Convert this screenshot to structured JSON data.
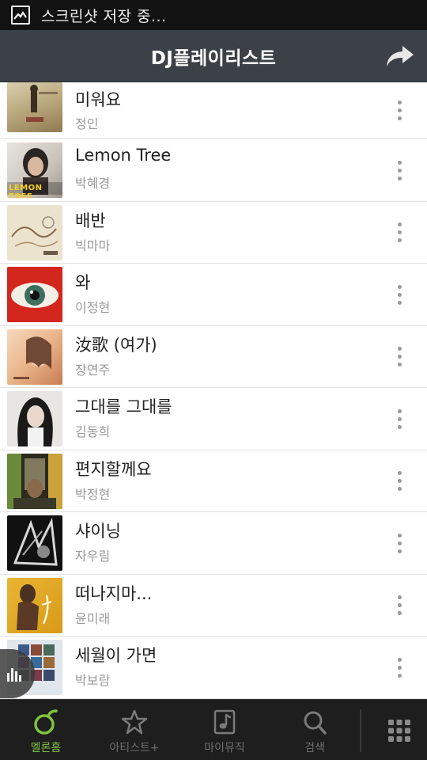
{
  "status_bar": {
    "text": "스크린샷 저장 중..."
  },
  "header": {
    "title": "DJ플레이리스트"
  },
  "songs": [
    {
      "title": "미워요",
      "artist": "정인"
    },
    {
      "title": "Lemon Tree",
      "artist": "박혜경",
      "art_text": "LEMON TREE"
    },
    {
      "title": "배반",
      "artist": "빅마마"
    },
    {
      "title": "와",
      "artist": "이정현"
    },
    {
      "title": "汝歌 (여가)",
      "artist": "장연주"
    },
    {
      "title": "그대를 그대를",
      "artist": "김동희"
    },
    {
      "title": "편지할께요",
      "artist": "박정현"
    },
    {
      "title": "샤이닝",
      "artist": "자우림"
    },
    {
      "title": "떠나지마...",
      "artist": "윤미래"
    },
    {
      "title": "세월이 가면",
      "artist": "박보람"
    }
  ],
  "tabs": [
    {
      "label": "멜론홈",
      "icon": "melon-home-icon",
      "active": true
    },
    {
      "label": "아티스트+",
      "icon": "star-icon",
      "active": false
    },
    {
      "label": "마이뮤직",
      "icon": "music-note-icon",
      "active": false
    },
    {
      "label": "검색",
      "icon": "search-icon",
      "active": false
    }
  ],
  "colors": {
    "accent": "#7fc241",
    "header_bg": "#3c4147",
    "tabbar_bg": "#1e1e1e"
  }
}
